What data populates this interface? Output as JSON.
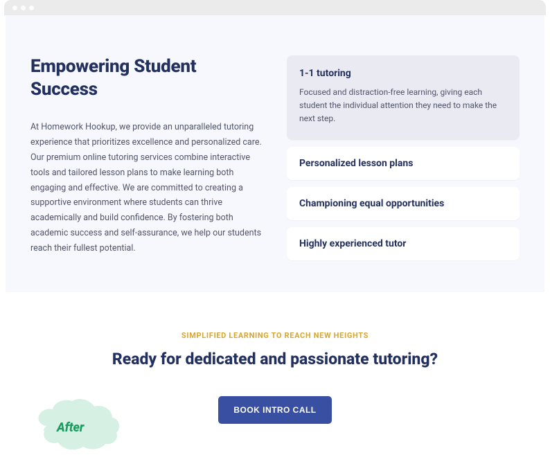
{
  "hero": {
    "headline": "Empowering Student Success",
    "body": "At Homework Hookup, we provide an unparalleled tutoring experience that prioritizes excellence and personalized care. Our premium online tutoring services combine interactive tools and tailored lesson plans to make learning both engaging and effective. We are committed to creating a supportive environment where students can thrive academically and build confidence. By fostering both academic success and self-assurance, we help our students reach their fullest potential."
  },
  "accordion": {
    "items": [
      {
        "title": "1-1 tutoring",
        "body": "Focused and distraction-free learning, giving each student the individual attention they need to make the next step."
      },
      {
        "title": "Personalized lesson plans"
      },
      {
        "title": "Championing equal opportunities"
      },
      {
        "title": "Highly experienced tutor"
      }
    ]
  },
  "cta": {
    "eyebrow": "SIMPLIFIED LEARNING TO REACH NEW HEIGHTS",
    "heading": "Ready for dedicated and passionate tutoring?",
    "button_label": "BOOK INTRO CALL"
  },
  "badge": {
    "label": "After"
  }
}
